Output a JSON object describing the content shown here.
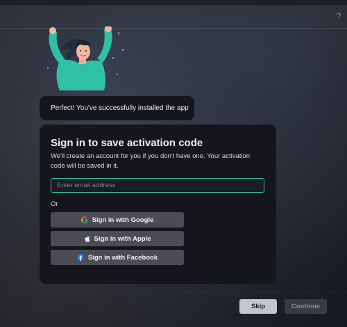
{
  "header": {
    "help_icon": "question-mark"
  },
  "hero": {
    "illustration": "woman-celebrating-illustration",
    "accent_color": "#2fc1a4"
  },
  "message": {
    "text": "Perfect! You've successfully installed the app"
  },
  "signin": {
    "title": "Sign in to save activation code",
    "description": "We'll create an account for you if you don't have one. Your activation code will be saved in it.",
    "email_placeholder": "Enter email address",
    "email_value": "",
    "or_label": "Or",
    "google_label": "Sign in with Google",
    "apple_label": "Sign in with Apple",
    "facebook_label": "Sign in with Facebook",
    "google_icon": "google-logo",
    "apple_icon": "apple-logo",
    "facebook_icon": "facebook-logo"
  },
  "footer": {
    "skip_label": "Skip",
    "continue_label": "Continue"
  }
}
